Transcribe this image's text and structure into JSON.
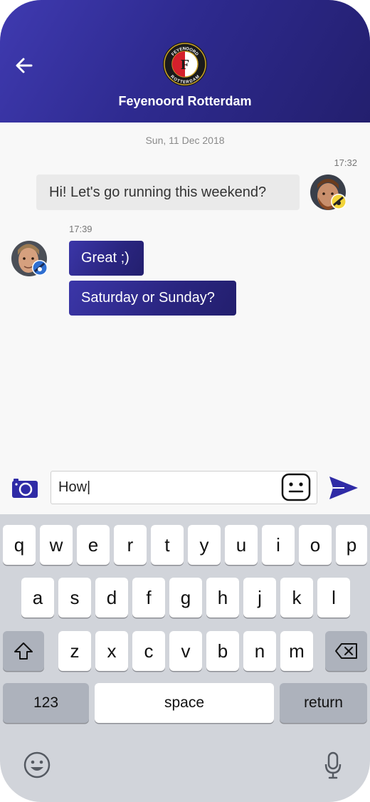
{
  "header": {
    "title": "Feyenoord Rotterdam",
    "logo_text_top": "FEYENOORD",
    "logo_text_bottom": "ROTTERDAM",
    "colors": {
      "gradient_start": "#3f3ab0",
      "gradient_end": "#231f6e"
    }
  },
  "chat": {
    "date": "Sun, 11 Dec 2018",
    "messages": [
      {
        "side": "right",
        "time": "17:32",
        "text": "Hi! Let's go running this weekend?"
      },
      {
        "side": "left",
        "time": "17:39",
        "text": "Great ;)"
      },
      {
        "side": "left",
        "time": "",
        "text": "Saturday or Sunday?"
      }
    ]
  },
  "composer": {
    "value": "How|",
    "camera_icon": "camera-icon",
    "emoji_icon": "emoji-face-icon",
    "send_icon": "send-icon"
  },
  "keyboard": {
    "row1": [
      "q",
      "w",
      "e",
      "r",
      "t",
      "y",
      "u",
      "i",
      "o",
      "p"
    ],
    "row2": [
      "a",
      "s",
      "d",
      "f",
      "g",
      "h",
      "j",
      "k",
      "l"
    ],
    "row3": [
      "z",
      "x",
      "c",
      "v",
      "b",
      "n",
      "m"
    ],
    "numbers_label": "123",
    "space_label": "space",
    "return_label": "return",
    "icons": [
      "shift-icon",
      "backspace-icon",
      "emoji-keyboard-icon",
      "microphone-icon"
    ]
  }
}
